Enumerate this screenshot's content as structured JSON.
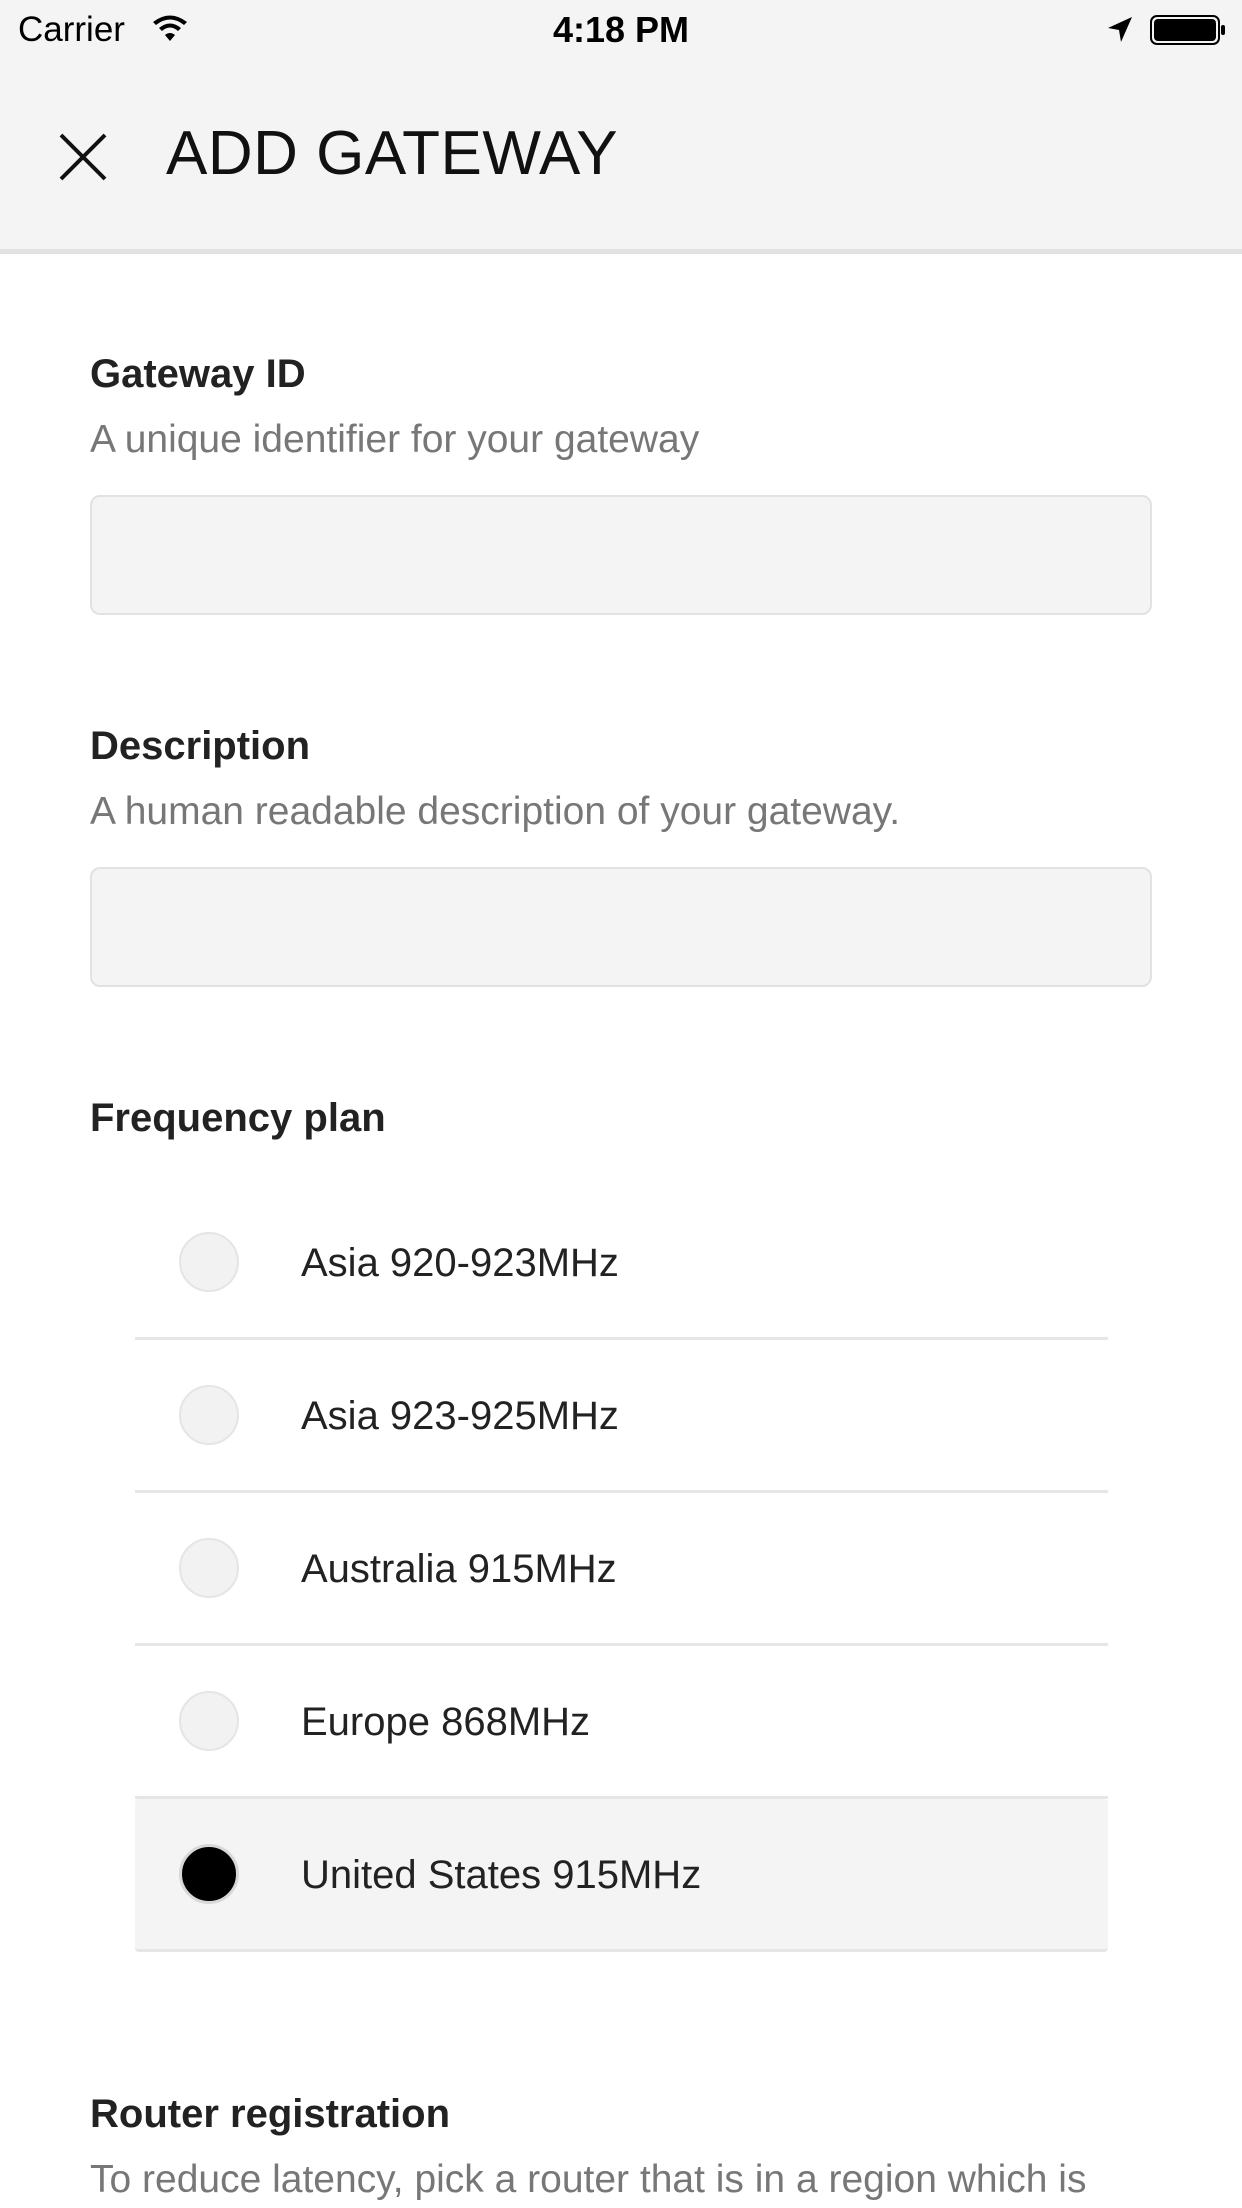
{
  "status_bar": {
    "carrier": "Carrier",
    "time": "4:18 PM",
    "icons": [
      "wifi-icon",
      "location-arrow-icon",
      "battery-icon"
    ]
  },
  "header": {
    "title": "ADD GATEWAY",
    "close_icon": "close-icon"
  },
  "form": {
    "gateway_id": {
      "label": "Gateway ID",
      "help": "A unique identifier for your gateway",
      "value": "",
      "placeholder": ""
    },
    "description": {
      "label": "Description",
      "help": "A human readable description of your gateway.",
      "value": "",
      "placeholder": ""
    },
    "frequency_plan": {
      "label": "Frequency plan",
      "selected": "United States 915MHz",
      "options": [
        {
          "label": "Asia 920-923MHz",
          "selected": false
        },
        {
          "label": "Asia 923-925MHz",
          "selected": false
        },
        {
          "label": "Australia 915MHz",
          "selected": false
        },
        {
          "label": "Europe 868MHz",
          "selected": false
        },
        {
          "label": "United States 915MHz",
          "selected": true
        }
      ]
    },
    "router_registration": {
      "label": "Router registration",
      "help": "To reduce latency, pick a router that is in a region which is"
    }
  },
  "colors": {
    "header_bg": "#f4f4f4",
    "input_bg": "#f4f4f4",
    "label_text": "#222222",
    "help_text": "#777777",
    "radio_checked": "#000000"
  }
}
